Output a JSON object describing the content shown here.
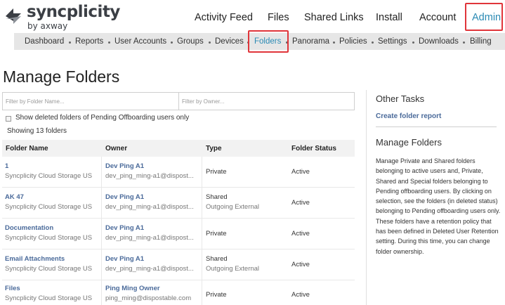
{
  "brand": {
    "name": "syncplicity",
    "sub": "by axway"
  },
  "topnav": [
    "Activity Feed",
    "Files",
    "Shared Links",
    "Install",
    "Account",
    "Admin"
  ],
  "subnav": [
    "Dashboard",
    "Reports",
    "User Accounts",
    "Groups",
    "Devices",
    "Folders",
    "Panorama",
    "Policies",
    "Settings",
    "Downloads",
    "Billing"
  ],
  "page_title": "Manage Folders",
  "filters": {
    "name_placeholder": "Filter by Folder Name...",
    "owner_placeholder": "Filter by Owner..."
  },
  "checkbox_label": "Show deleted folders of Pending Offboarding users only",
  "showing": "Showing 13 folders",
  "columns": [
    "Folder Name",
    "Owner",
    "Type",
    "Folder Status"
  ],
  "rows": [
    {
      "name": "1",
      "storage": "Syncplicity Cloud Storage US",
      "owner": "Dev Ping A1",
      "email": "dev_ping_ming-a1@dispost...",
      "type": "Private",
      "subtype": "",
      "status": "Active"
    },
    {
      "name": "AK 47",
      "storage": "Syncplicity Cloud Storage US",
      "owner": "Dev Ping A1",
      "email": "dev_ping_ming-a1@dispost...",
      "type": "Shared",
      "subtype": "Outgoing External",
      "status": "Active"
    },
    {
      "name": "Documentation",
      "storage": "Syncplicity Cloud Storage US",
      "owner": "Dev Ping A1",
      "email": "dev_ping_ming-a1@dispost...",
      "type": "Private",
      "subtype": "",
      "status": "Active"
    },
    {
      "name": "Email Attachments",
      "storage": "Syncplicity Cloud Storage US",
      "owner": "Dev Ping A1",
      "email": "dev_ping_ming-a1@dispost...",
      "type": "Shared",
      "subtype": "Outgoing External",
      "status": "Active"
    },
    {
      "name": "Files",
      "storage": "Syncplicity Cloud Storage US",
      "owner": "Ping Ming Owner",
      "email": "ping_ming@dispostable.com",
      "type": "Private",
      "subtype": "",
      "status": "Active"
    }
  ],
  "sidebar": {
    "other_tasks_title": "Other Tasks",
    "create_report": "Create folder report",
    "manage_title": "Manage Folders",
    "description": "Manage Private and Shared folders belonging to active users and, Private, Shared and Special folders belonging to Pending offboarding users. By clicking on selection, see the folders (in deleted status) belonging to Pending offboarding users only. These folders have a retention policy that has been defined in Deleted User Retention setting. During this time, you can change folder ownership."
  },
  "colors": {
    "accent": "#2a8ab4",
    "highlight_box": "#e0353a",
    "link": "#4a6a9a"
  }
}
